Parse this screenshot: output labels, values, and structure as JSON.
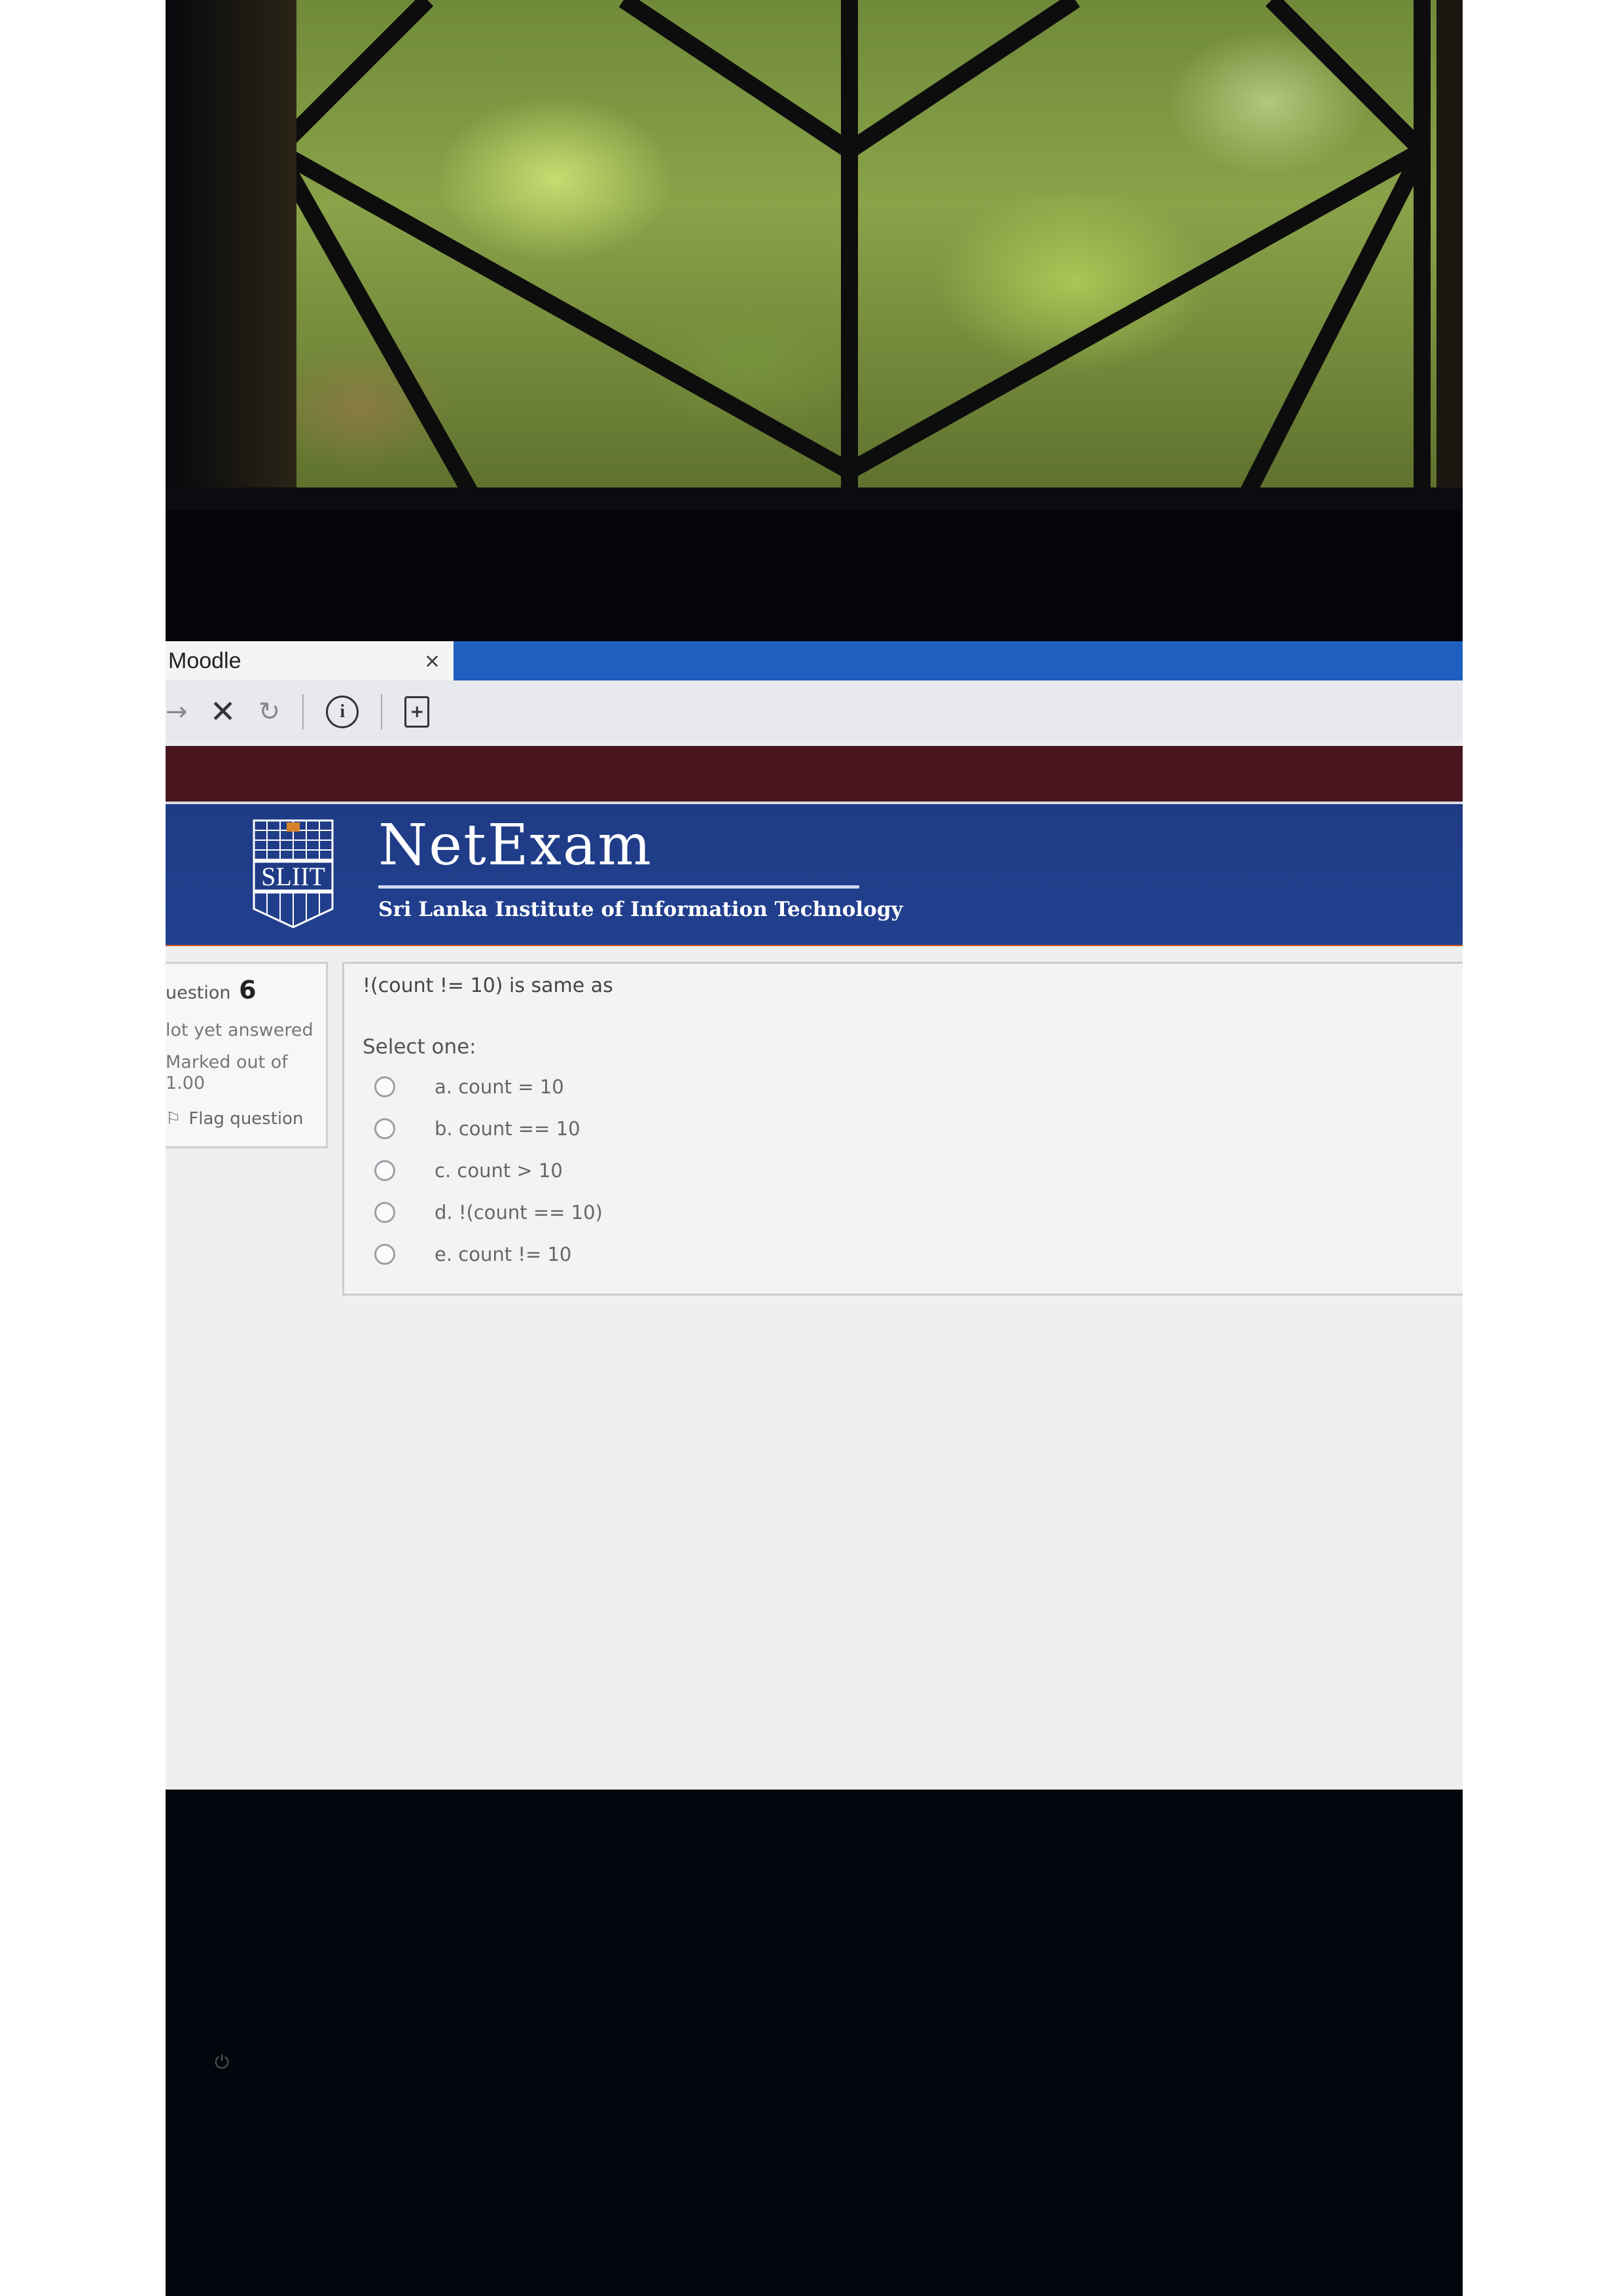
{
  "browser": {
    "tab_title": "Moodle",
    "tab_close": "×",
    "toolbar": {
      "forward": "→",
      "stop": "✕",
      "reload": "↻",
      "info": "i",
      "page_action": "+"
    }
  },
  "banner": {
    "logo_alt": "SLIIT",
    "title": "NetExam",
    "subtitle": "Sri Lanka Institute of Information Technology"
  },
  "question_info": {
    "label": "uestion",
    "number": "6",
    "state": "lot yet answered",
    "marked": "Marked out of",
    "marks": "1.00",
    "flag": "Flag question"
  },
  "question": {
    "text": "!(count != 10) is same as",
    "prompt": "Select one:",
    "options": [
      "a. count = 10",
      "b. count == 10",
      "c. count > 10",
      "d. !(count == 10)",
      "e. count != 10"
    ]
  },
  "colors": {
    "tab_bar": "#1f5fbf",
    "maroon_bar": "#4a1620",
    "banner": "#22408f",
    "banner_accent": "#c75a2a"
  }
}
